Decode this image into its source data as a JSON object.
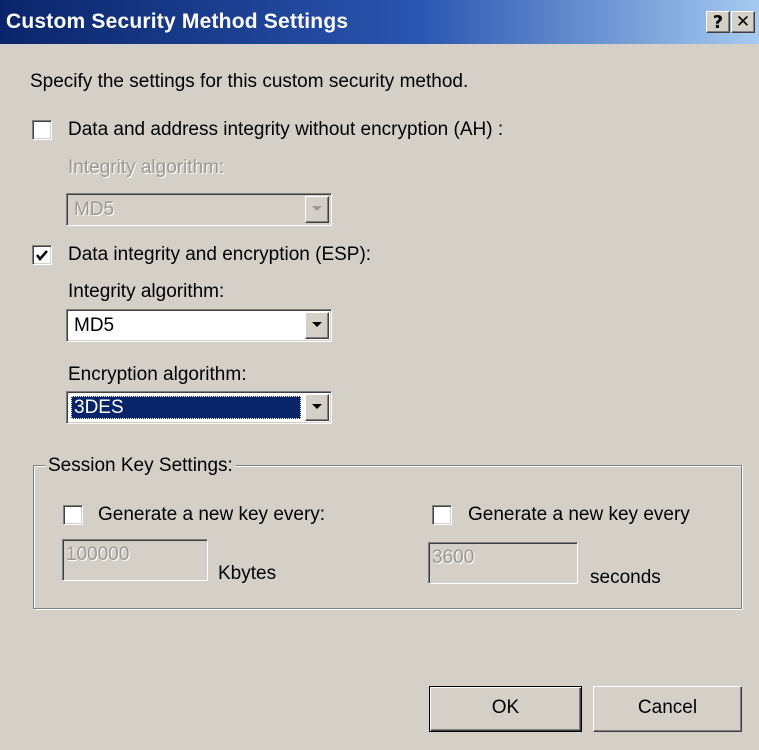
{
  "window": {
    "title": "Custom Security Method Settings",
    "help_glyph": "?",
    "close_glyph": "✕"
  },
  "intro": "Specify the settings for this custom security method.",
  "ah": {
    "label": "Data and address integrity without encryption (AH) :",
    "checked": false,
    "integrity_label": "Integrity algorithm:",
    "integrity_value": "MD5",
    "enabled": false
  },
  "esp": {
    "label": "Data integrity and encryption (ESP):",
    "checked": true,
    "integrity_label": "Integrity algorithm:",
    "integrity_value": "MD5",
    "encryption_label": "Encryption algorithm:",
    "encryption_value": "3DES"
  },
  "session": {
    "legend": "Session Key Settings:",
    "kbytes_label": "Generate a new key every:",
    "kbytes_checked": false,
    "kbytes_value": "100000",
    "kbytes_unit": "Kbytes",
    "seconds_label": "Generate a new key every",
    "seconds_checked": false,
    "seconds_value": "3600",
    "seconds_unit": "seconds"
  },
  "buttons": {
    "ok": "OK",
    "cancel": "Cancel"
  },
  "colors": {
    "dialog_bg": "#d4d0c8",
    "title_bar": "#0a246a",
    "selection": "#0a246a"
  }
}
